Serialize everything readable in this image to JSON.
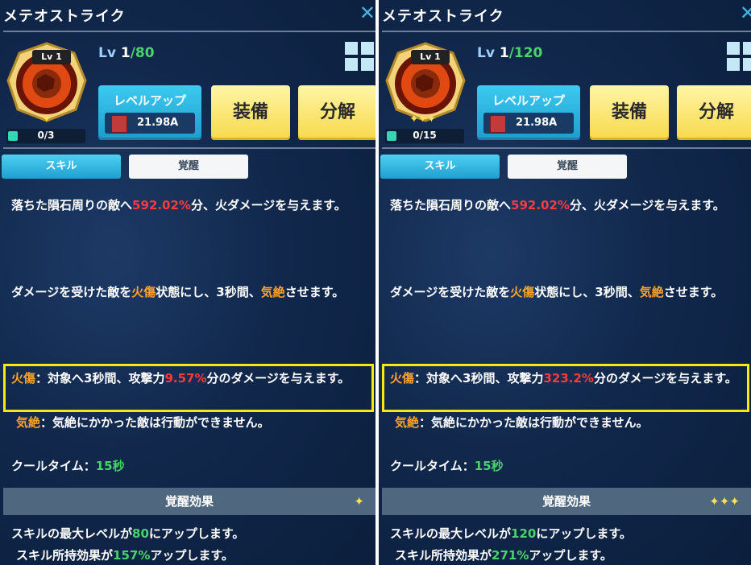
{
  "colors": {
    "accent_blue": "#3ccaf0",
    "gold_button": "#f7d94a",
    "highlight": "#ffe512",
    "percent_red": "#ff3b3b",
    "status_orange": "#ffa32a",
    "value_green": "#49d36c"
  },
  "panels": [
    {
      "title": "メテオストライク",
      "close_icon": "✕",
      "emblem_level": "Lv 1",
      "stars": "✦",
      "fragments": "0/3",
      "level_label": "Lv",
      "level_current": "1",
      "level_max": "/80",
      "levelup_label": "レベルアップ",
      "levelup_cost": "21.98A",
      "equip_label": "装備",
      "disassemble_label": "分解",
      "tab_skill": "スキル",
      "tab_awaken": "覚醒",
      "desc1_a": "落ちた隕石周りの敵へ",
      "desc1_pct": "592.02%",
      "desc1_b": "分、火ダメージを与えます。",
      "desc2_a": "ダメージを受けた敵を",
      "desc2_burn": "火傷",
      "desc2_b": "状態にし、3秒間、",
      "desc2_stun": "気絶",
      "desc2_c": "させます。",
      "burn_label": "火傷",
      "burn_a": "：対象へ3秒間、攻撃力",
      "burn_pct": "9.57%",
      "burn_b": "分のダメージを与えます。",
      "stun_label": "気絶",
      "stun_text": "：気絶にかかった敵は行動ができません。",
      "cooldown_label": "クールタイム：",
      "cooldown_value": "15秒",
      "awaken_header": "覚醒効果",
      "awaken_stars": "✦",
      "effect1_a": "スキルの最大レベルが",
      "effect1_val": "80",
      "effect1_b": "にアップします。",
      "effect2_a": "スキル所持効果が",
      "effect2_val": "157%",
      "effect2_b": "アップします。"
    },
    {
      "title": "メテオストライク",
      "close_icon": "✕",
      "emblem_level": "Lv 1",
      "stars": "✦✦✦",
      "fragments": "0/15",
      "level_label": "Lv",
      "level_current": "1",
      "level_max": "/120",
      "levelup_label": "レベルアップ",
      "levelup_cost": "21.98A",
      "equip_label": "装備",
      "disassemble_label": "分解",
      "tab_skill": "スキル",
      "tab_awaken": "覚醒",
      "desc1_a": "落ちた隕石周りの敵へ",
      "desc1_pct": "592.02%",
      "desc1_b": "分、火ダメージを与えます。",
      "desc2_a": "ダメージを受けた敵を",
      "desc2_burn": "火傷",
      "desc2_b": "状態にし、3秒間、",
      "desc2_stun": "気絶",
      "desc2_c": "させます。",
      "burn_label": "火傷",
      "burn_a": "：対象へ3秒間、攻撃力",
      "burn_pct": "323.2%",
      "burn_b": "分のダメージを与えます。",
      "stun_label": "気絶",
      "stun_text": "：気絶にかかった敵は行動ができません。",
      "cooldown_label": "クールタイム：",
      "cooldown_value": "15秒",
      "awaken_header": "覚醒効果",
      "awaken_stars": "✦✦✦",
      "effect1_a": "スキルの最大レベルが",
      "effect1_val": "120",
      "effect1_b": "にアップします。",
      "effect2_a": "スキル所持効果が",
      "effect2_val": "271%",
      "effect2_b": "アップします。"
    }
  ]
}
